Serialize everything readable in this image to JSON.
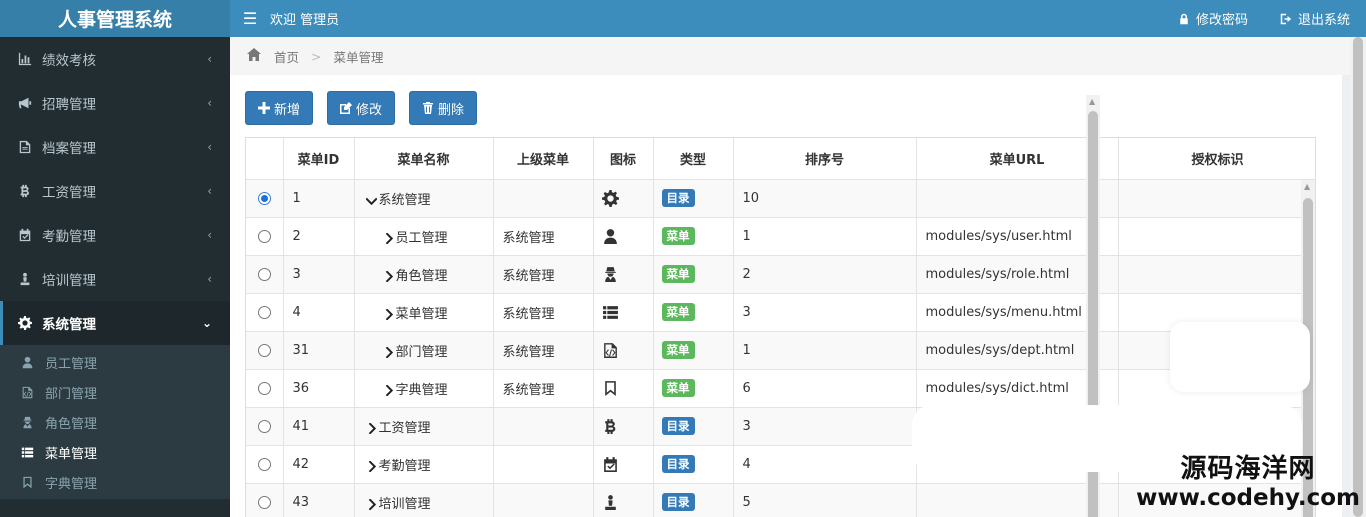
{
  "app": {
    "title": "人事管理系统"
  },
  "topbar": {
    "welcome": "欢迎 管理员",
    "change_password": "修改密码",
    "logout": "退出系统"
  },
  "sidebar": {
    "items": [
      {
        "label": "绩效考核",
        "icon": "bar-chart-icon"
      },
      {
        "label": "招聘管理",
        "icon": "bullhorn-icon"
      },
      {
        "label": "档案管理",
        "icon": "file-icon"
      },
      {
        "label": "工资管理",
        "icon": "bitcoin-icon"
      },
      {
        "label": "考勤管理",
        "icon": "calendar-check-icon"
      },
      {
        "label": "培训管理",
        "icon": "user-training-icon"
      },
      {
        "label": "系统管理",
        "icon": "gear-icon",
        "active": true
      }
    ],
    "subitems": [
      {
        "label": "员工管理",
        "icon": "user-icon"
      },
      {
        "label": "部门管理",
        "icon": "file-code-icon"
      },
      {
        "label": "角色管理",
        "icon": "user-secret-icon"
      },
      {
        "label": "菜单管理",
        "icon": "list-icon",
        "active": true
      },
      {
        "label": "字典管理",
        "icon": "bookmark-icon"
      }
    ]
  },
  "breadcrumb": {
    "home": "首页",
    "current": "菜单管理"
  },
  "toolbar": {
    "add": "新增",
    "edit": "修改",
    "delete": "删除"
  },
  "table": {
    "columns": [
      "菜单ID",
      "菜单名称",
      "上级菜单",
      "图标",
      "类型",
      "排序号",
      "菜单URL",
      "授权标识"
    ],
    "rows": [
      {
        "id": "1",
        "name": "系统管理",
        "level": 0,
        "expanded": true,
        "parent": "",
        "icon": "gear-icon",
        "type": "目录",
        "order": "10",
        "url": "",
        "perm": "",
        "selected": true
      },
      {
        "id": "2",
        "name": "员工管理",
        "level": 1,
        "parent": "系统管理",
        "icon": "user-icon",
        "type": "菜单",
        "order": "1",
        "url": "modules/sys/user.html",
        "perm": ""
      },
      {
        "id": "3",
        "name": "角色管理",
        "level": 1,
        "parent": "系统管理",
        "icon": "user-secret-icon",
        "type": "菜单",
        "order": "2",
        "url": "modules/sys/role.html",
        "perm": ""
      },
      {
        "id": "4",
        "name": "菜单管理",
        "level": 1,
        "parent": "系统管理",
        "icon": "list-icon",
        "type": "菜单",
        "order": "3",
        "url": "modules/sys/menu.html",
        "perm": ""
      },
      {
        "id": "31",
        "name": "部门管理",
        "level": 1,
        "parent": "系统管理",
        "icon": "file-code-icon",
        "type": "菜单",
        "order": "1",
        "url": "modules/sys/dept.html",
        "perm": ""
      },
      {
        "id": "36",
        "name": "字典管理",
        "level": 1,
        "parent": "系统管理",
        "icon": "bookmark-icon",
        "type": "菜单",
        "order": "6",
        "url": "modules/sys/dict.html",
        "perm": ""
      },
      {
        "id": "41",
        "name": "工资管理",
        "level": 0,
        "parent": "",
        "icon": "bitcoin-icon",
        "type": "目录",
        "order": "3",
        "url": "",
        "perm": ""
      },
      {
        "id": "42",
        "name": "考勤管理",
        "level": 0,
        "parent": "",
        "icon": "calendar-check-icon",
        "type": "目录",
        "order": "4",
        "url": "",
        "perm": ""
      },
      {
        "id": "43",
        "name": "培训管理",
        "level": 0,
        "parent": "",
        "icon": "user-training-icon",
        "type": "目录",
        "order": "5",
        "url": "",
        "perm": ""
      }
    ]
  },
  "watermark": {
    "cn": "源码海洋网",
    "en": "www.codehy.com"
  },
  "colors": {
    "header": "#3c8dbc",
    "logo": "#367fa9",
    "sidebar": "#222d32",
    "btn_primary": "#337ab7",
    "tag_dir": "#337ab7",
    "tag_menu": "#5cb85c"
  }
}
